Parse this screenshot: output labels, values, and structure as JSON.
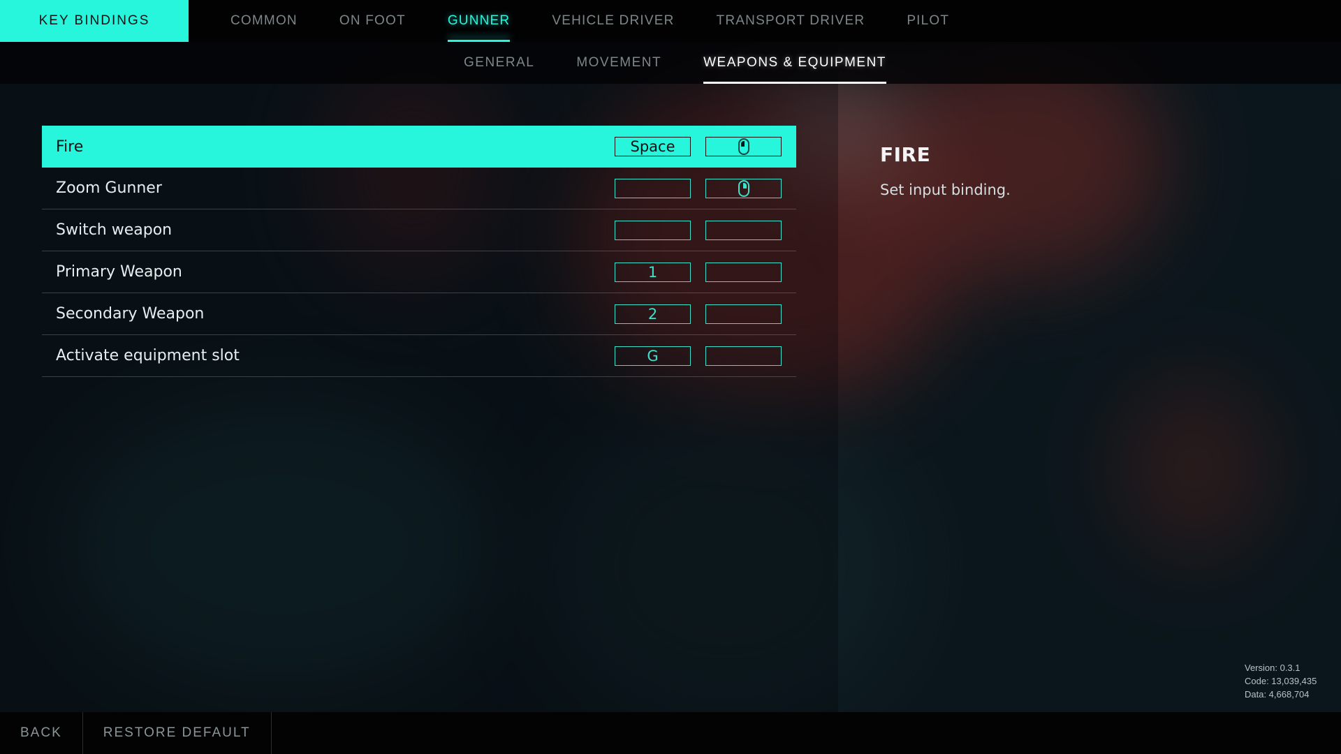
{
  "header": {
    "title": "KEY BINDINGS",
    "tabs": [
      {
        "label": "COMMON",
        "active": false
      },
      {
        "label": "ON FOOT",
        "active": false
      },
      {
        "label": "GUNNER",
        "active": true
      },
      {
        "label": "VEHICLE DRIVER",
        "active": false
      },
      {
        "label": "TRANSPORT DRIVER",
        "active": false
      },
      {
        "label": "PILOT",
        "active": false
      }
    ]
  },
  "subtabs": [
    {
      "label": "GENERAL",
      "active": false
    },
    {
      "label": "MOVEMENT",
      "active": false
    },
    {
      "label": "WEAPONS & EQUIPMENT",
      "active": true
    }
  ],
  "bindings": [
    {
      "action": "Fire",
      "keyboard": "Space",
      "mouse": "mouse-left-button-icon",
      "selected": true
    },
    {
      "action": "Zoom Gunner",
      "keyboard": "",
      "mouse": "mouse-right-button-icon",
      "selected": false
    },
    {
      "action": "Switch weapon",
      "keyboard": "",
      "mouse": "",
      "selected": false
    },
    {
      "action": "Primary Weapon",
      "keyboard": "1",
      "mouse": "",
      "selected": false
    },
    {
      "action": "Secondary Weapon",
      "keyboard": "2",
      "mouse": "",
      "selected": false
    },
    {
      "action": "Activate equipment slot",
      "keyboard": "G",
      "mouse": "",
      "selected": false
    }
  ],
  "detail": {
    "title": "FIRE",
    "description": "Set input binding."
  },
  "version_info": {
    "version": "Version: 0.3.1",
    "code": "Code: 13,039,435",
    "data": "Data: 4,668,704"
  },
  "footer": {
    "back_label": "BACK",
    "restore_label": "RESTORE DEFAULT"
  },
  "colors": {
    "accent": "#27f5dc",
    "binding_outline": "#3fe0cc",
    "inactive_text": "#7d8789"
  }
}
